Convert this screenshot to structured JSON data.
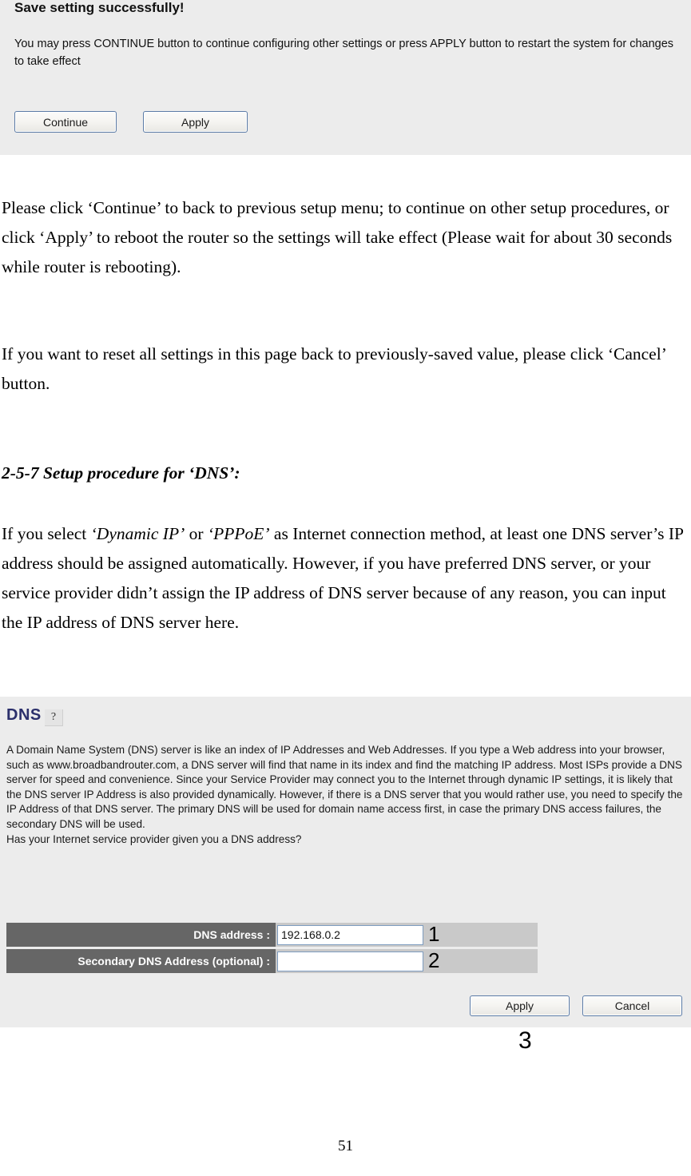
{
  "save_panel": {
    "title": "Save setting successfully!",
    "description": "You may press CONTINUE button to continue configuring other settings or press APPLY button to restart the system for changes to take effect",
    "continue_label": "Continue",
    "apply_label": "Apply",
    "background": "#ececec"
  },
  "document": {
    "paragraph_1": "Please click ‘Continue’ to back to previous setup menu; to continue on other setup procedures, or click ‘Apply’ to reboot the router so the settings will take effect (Please wait for about 30 seconds while router is rebooting).",
    "paragraph_2": "If you want to reset all settings in this page back to previously-saved value, please click ‘Cancel’ button.",
    "heading_2_5_7": "2-5-7 Setup procedure for ‘DNS’:",
    "paragraph_3": "If you select ‘Dynamic IP’ or ‘PPPoE’ as Internet connection method, at least one DNS server’s IP address should be assigned automatically. However, if you have preferred DNS server, or your service provider didn’t assign the IP address of DNS server because of any reason, you can input the IP address of DNS server here.",
    "page_number": "51"
  },
  "dns_panel": {
    "title": "DNS",
    "help_icon_glyph": "?",
    "title_color": "#2b2f6b",
    "description": "A Domain Name System (DNS) server is like an index of IP Addresses and Web Addresses. If you type a Web address into your browser, such as www.broadbandrouter.com, a DNS server will find that name in its index and find the matching IP address. Most ISPs provide a DNS server for speed and convenience. Since your Service Provider may connect you to the Internet through dynamic IP settings, it is likely that the DNS server IP Address is also provided dynamically. However, if there is a DNS server that you would rather use, you need to specify the IP Address of that DNS server. The primary DNS will be used for domain name access first, in case the primary DNS access failures, the secondary DNS will be used.",
    "description_question": "Has your Internet service provider given you a DNS address?",
    "rows": [
      {
        "label": "DNS address :",
        "value": "192.168.0.2",
        "placeholder": "",
        "callout": "1"
      },
      {
        "label": "Secondary DNS Address (optional) :",
        "value": "",
        "placeholder": "",
        "callout": "2"
      }
    ],
    "apply_label": "Apply",
    "cancel_label": "Cancel",
    "label_cell_color": "#666666",
    "value_cell_color": "#c9c9c9"
  },
  "callouts": {
    "three": "3"
  }
}
